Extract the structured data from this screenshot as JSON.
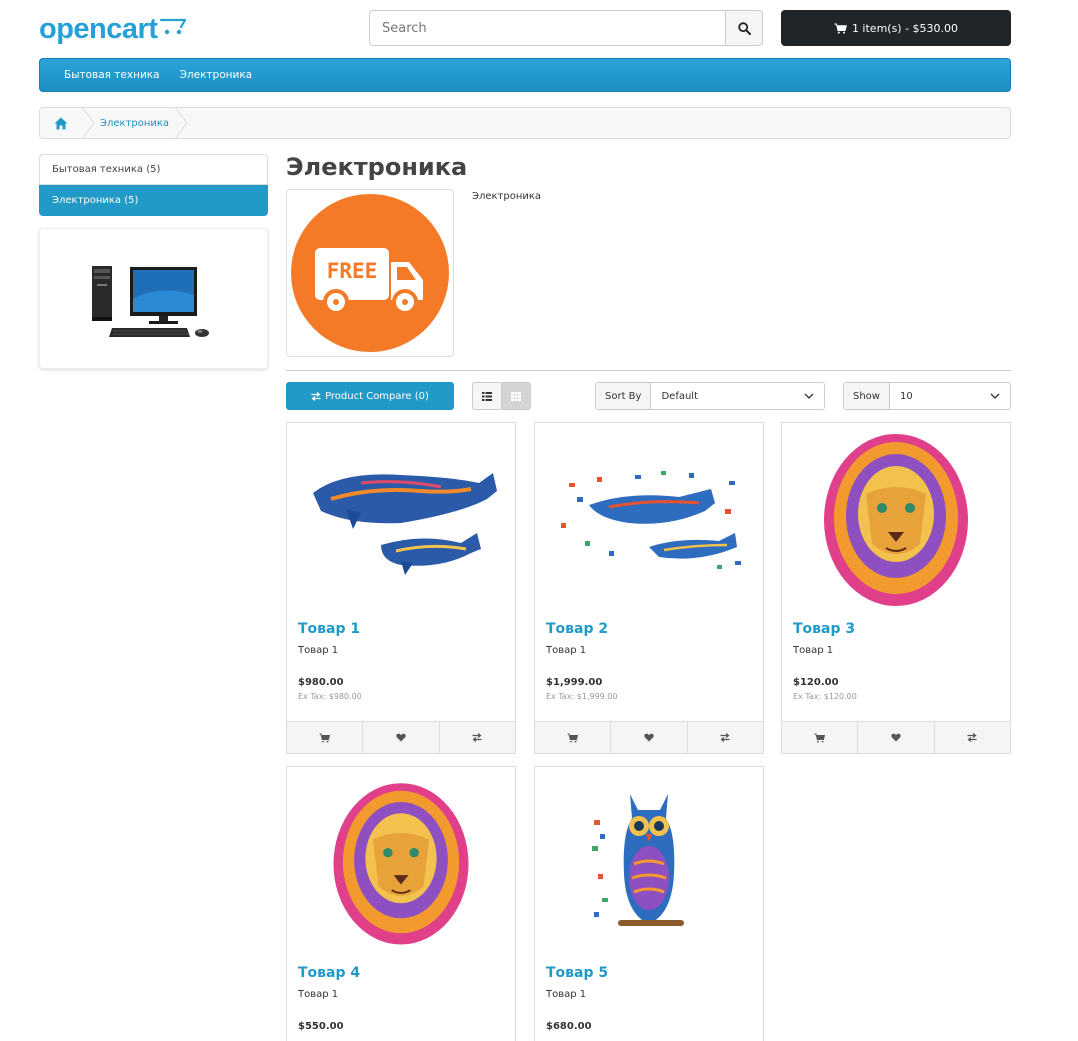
{
  "header": {
    "logo_text": "opencart",
    "search_placeholder": "Search",
    "cart_label": "1 item(s) - $530.00"
  },
  "menu": {
    "items": [
      "Бытовая техника",
      "Электроника"
    ]
  },
  "breadcrumb": {
    "items": [
      "Электроника"
    ]
  },
  "sidebar": {
    "categories": [
      {
        "label": "Бытовая техника (5)",
        "active": false
      },
      {
        "label": "Электроника (5)",
        "active": true
      }
    ]
  },
  "category": {
    "title": "Электроника",
    "description": "Электроника",
    "thumb_text": "FREE"
  },
  "toolbar": {
    "compare_label": "Product Compare (0)",
    "sort_label": "Sort By",
    "sort_value": "Default",
    "show_label": "Show",
    "show_value": "10"
  },
  "products": [
    {
      "name": "Товар 1",
      "desc": "Товар 1",
      "price": "$980.00",
      "tax": "Ex Tax: $980.00",
      "image": "whale-puzzle"
    },
    {
      "name": "Товар 2",
      "desc": "Товар 1",
      "price": "$1,999.00",
      "tax": "Ex Tax: $1,999.00",
      "image": "whale-puzzle-scattered"
    },
    {
      "name": "Товар 3",
      "desc": "Товар 1",
      "price": "$120.00",
      "tax": "Ex Tax: $120.00",
      "image": "lion-puzzle"
    },
    {
      "name": "Товар 4",
      "desc": "Товар 1",
      "price": "$550.00",
      "tax": "",
      "image": "lion-puzzle"
    },
    {
      "name": "Товар 5",
      "desc": "Товар 1",
      "price": "$680.00",
      "tax": "",
      "image": "owl-puzzle"
    }
  ],
  "colors": {
    "brand": "#229ac8",
    "cart_bg": "#212529",
    "thumb_orange": "#f47a28"
  }
}
